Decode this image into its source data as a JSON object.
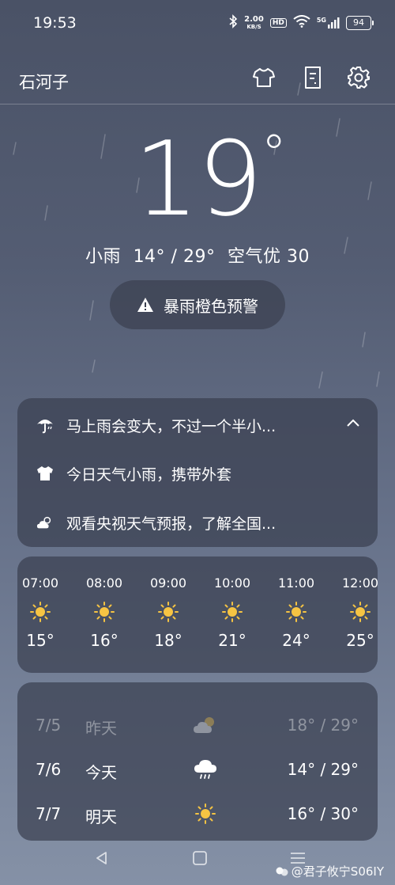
{
  "status_bar": {
    "time": "19:53",
    "net_speed_value": "2.00",
    "net_speed_unit": "KB/S",
    "hd_label": "HD",
    "signal_label": "5G",
    "battery_level": "94"
  },
  "header": {
    "city": "石河子"
  },
  "current": {
    "temperature": "19",
    "degree_symbol": "°",
    "condition": "小雨",
    "range": "14° / 29°",
    "air_quality": "空气优 30"
  },
  "alert": {
    "text": "暴雨橙色预警"
  },
  "tips": [
    {
      "icon": "umbrella-icon",
      "text": "马上雨会变大，不过一个半小..."
    },
    {
      "icon": "shirt-icon",
      "text": "今日天气小雨，携带外套"
    },
    {
      "icon": "partly-cloudy-icon",
      "text": "观看央视天气预报，了解全国..."
    }
  ],
  "hourly": [
    {
      "time": "07:00",
      "icon": "sun-icon",
      "temp": "15°"
    },
    {
      "time": "08:00",
      "icon": "sun-icon",
      "temp": "16°"
    },
    {
      "time": "09:00",
      "icon": "sun-icon",
      "temp": "18°"
    },
    {
      "time": "10:00",
      "icon": "sun-icon",
      "temp": "21°"
    },
    {
      "time": "11:00",
      "icon": "sun-icon",
      "temp": "24°"
    },
    {
      "time": "12:00",
      "icon": "sun-icon",
      "temp": "25°"
    }
  ],
  "daily": [
    {
      "date": "7/5",
      "label": "昨天",
      "icon": "partly-cloudy-icon",
      "range": "18° / 29°"
    },
    {
      "date": "7/6",
      "label": "今天",
      "icon": "rain-icon",
      "range": "14° / 29°"
    },
    {
      "date": "7/7",
      "label": "明天",
      "icon": "sun-icon",
      "range": "16° / 30°"
    }
  ],
  "watermark": {
    "text": "@君子攸宁S06IY"
  },
  "colors": {
    "sun": "#f6c443",
    "card_bg": "#3a4050",
    "text": "#ffffff"
  }
}
